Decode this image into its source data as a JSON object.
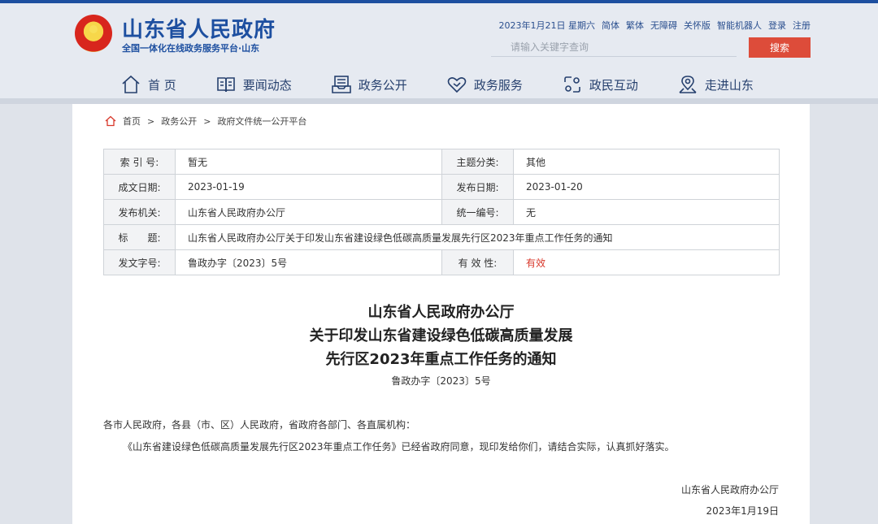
{
  "site": {
    "title": "山东省人民政府",
    "subtitle": "全国一体化在线政务服务平台·山东"
  },
  "util": {
    "date": "2023年1月21日 星期六",
    "links": [
      "简体",
      "繁体",
      "无障碍",
      "关怀版",
      "智能机器人",
      "登录",
      "注册"
    ]
  },
  "search": {
    "placeholder": "请输入关键字查询",
    "button": "搜索"
  },
  "nav": [
    {
      "label": "首 页",
      "icon": "home-icon"
    },
    {
      "label": "要闻动态",
      "icon": "book-icon"
    },
    {
      "label": "政务公开",
      "icon": "inbox-icon"
    },
    {
      "label": "政务服务",
      "icon": "heart-icon"
    },
    {
      "label": "政民互动",
      "icon": "interaction-icon"
    },
    {
      "label": "走进山东",
      "icon": "location-icon"
    }
  ],
  "breadcrumb": {
    "home": "首页",
    "sep": ">",
    "level1": "政务公开",
    "level2": "政府文件统一公开平台"
  },
  "meta": {
    "index_label": "索 引 号:",
    "index_value": "暂无",
    "topic_label": "主题分类:",
    "topic_value": "其他",
    "created_label": "成文日期:",
    "created_value": "2023-01-19",
    "published_label": "发布日期:",
    "published_value": "2023-01-20",
    "issuer_label": "发布机关:",
    "issuer_value": "山东省人民政府办公厅",
    "unified_label": "统一编号:",
    "unified_value": "无",
    "title_label": "标　　题:",
    "title_value": "山东省人民政府办公厅关于印发山东省建设绿色低碳高质量发展先行区2023年重点工作任务的通知",
    "docno_label": "发文字号:",
    "docno_value": "鲁政办字〔2023〕5号",
    "validity_label": "有 效 性:",
    "validity_value": "有效"
  },
  "doc": {
    "title_line1": "山东省人民政府办公厅",
    "title_line2": "关于印发山东省建设绿色低碳高质量发展",
    "title_line3": "先行区2023年重点工作任务的通知",
    "doc_no": "鲁政办字〔2023〕5号",
    "addressee": "各市人民政府，各县（市、区）人民政府，省政府各部门、各直属机构：",
    "body": "《山东省建设绿色低碳高质量发展先行区2023年重点工作任务》已经省政府同意，现印发给你们，请结合实际，认真抓好落实。",
    "sign_org": "山东省人民政府办公厅",
    "sign_date": "2023年1月19日"
  },
  "colors": {
    "brand": "#1d4fa0",
    "accent": "#dd4c3a",
    "valid": "#d8382b"
  }
}
